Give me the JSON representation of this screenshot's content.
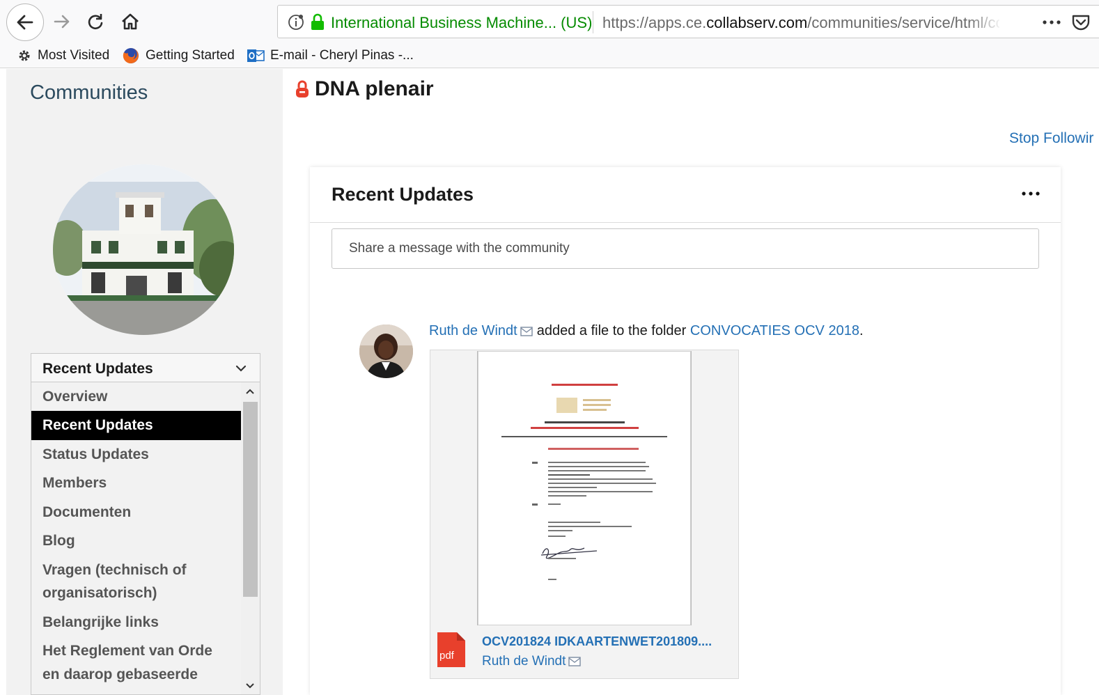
{
  "browser": {
    "site_identity": "International Business Machine... (US)",
    "url_prefix": "https://apps.ce.",
    "url_domain": "collabserv.com",
    "url_path": "/communities/service/html/cc",
    "bookmarks": [
      {
        "label": "Most Visited",
        "icon": "gear-icon"
      },
      {
        "label": "Getting Started",
        "icon": "firefox-icon"
      },
      {
        "label": "E-mail - Cheryl Pinas -...",
        "icon": "outlook-icon"
      }
    ]
  },
  "sidebar": {
    "title": "Communities",
    "nav_selected": "Recent Updates",
    "nav_items": [
      {
        "label": "Overview",
        "active": false
      },
      {
        "label": "Recent Updates",
        "active": true
      },
      {
        "label": "Status Updates",
        "active": false
      },
      {
        "label": "Members",
        "active": false
      },
      {
        "label": "Documenten",
        "active": false
      },
      {
        "label": "Blog",
        "active": false
      },
      {
        "label": "Vragen (technisch of",
        "active": false
      },
      {
        "label": "organisatorisch)",
        "active": false
      },
      {
        "label": "Belangrijke links",
        "active": false
      },
      {
        "label": "Het Reglement van Orde",
        "active": false
      },
      {
        "label": "en daarop gebaseerde",
        "active": false
      }
    ]
  },
  "main": {
    "community_title": "DNA plenair",
    "stop_following": "Stop Followir",
    "card": {
      "title": "Recent Updates",
      "share_placeholder": "Share a message with the community",
      "activity": {
        "user": "Ruth de Windt",
        "action": "added a file to the folder",
        "folder": "CONVOCATIES OCV 2018",
        "end": "."
      },
      "file": {
        "type_label": "pdf",
        "name": "OCV201824 IDKAARTENWET201809....",
        "author": "Ruth de Windt"
      }
    }
  },
  "colors": {
    "link": "#2470b5",
    "secure_green": "#058b00",
    "active_nav_bg": "#000000",
    "pdf_red": "#e8402c"
  }
}
